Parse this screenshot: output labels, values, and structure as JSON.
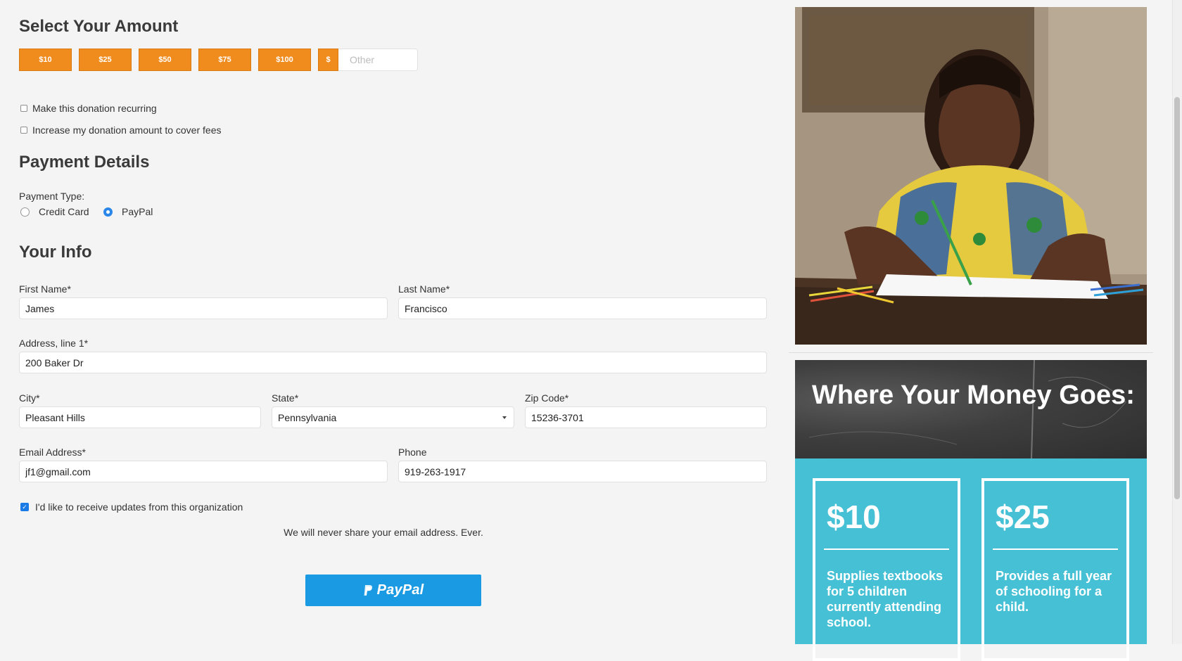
{
  "amount": {
    "heading": "Select Your Amount",
    "buttons": [
      "$10",
      "$25",
      "$50",
      "$75",
      "$100"
    ],
    "currency": "$",
    "other_placeholder": "Other"
  },
  "options": {
    "recurring": {
      "label": "Make this donation recurring",
      "checked": false
    },
    "cover_fees": {
      "label": "Increase my donation amount to cover fees",
      "checked": false
    }
  },
  "payment": {
    "heading": "Payment Details",
    "type_label": "Payment Type:",
    "options": [
      {
        "label": "Credit Card",
        "selected": false
      },
      {
        "label": "PayPal",
        "selected": true
      }
    ]
  },
  "info": {
    "heading": "Your Info",
    "first_name": {
      "label": "First Name*",
      "value": "James"
    },
    "last_name": {
      "label": "Last Name*",
      "value": "Francisco"
    },
    "address1": {
      "label": "Address, line 1*",
      "value": "200 Baker Dr"
    },
    "city": {
      "label": "City*",
      "value": "Pleasant Hills"
    },
    "state": {
      "label": "State*",
      "value": "Pennsylvania"
    },
    "zip": {
      "label": "Zip Code*",
      "value": "15236-3701"
    },
    "email": {
      "label": "Email Address*",
      "value": "jf1@gmail.com"
    },
    "phone": {
      "label": "Phone",
      "value": "919-263-1917"
    }
  },
  "updates": {
    "label": "I'd like to receive updates from this organization",
    "checked": true
  },
  "privacy_note": "We will never share your email address.  Ever.",
  "paypal_button": {
    "label": "PayPal",
    "color": "#1b9ae4"
  },
  "sidebar": {
    "chalk_title": "Where Your Money Goes:",
    "cards": [
      {
        "amount": "$10",
        "description": "Supplies textbooks for 5 children currently attending school."
      },
      {
        "amount": "$25",
        "description": "Provides a full year of schooling for a child."
      }
    ],
    "teal_color": "#45c0d4"
  },
  "colors": {
    "accent_orange": "#f08c1e",
    "checkbox_blue": "#1a7ae6"
  }
}
